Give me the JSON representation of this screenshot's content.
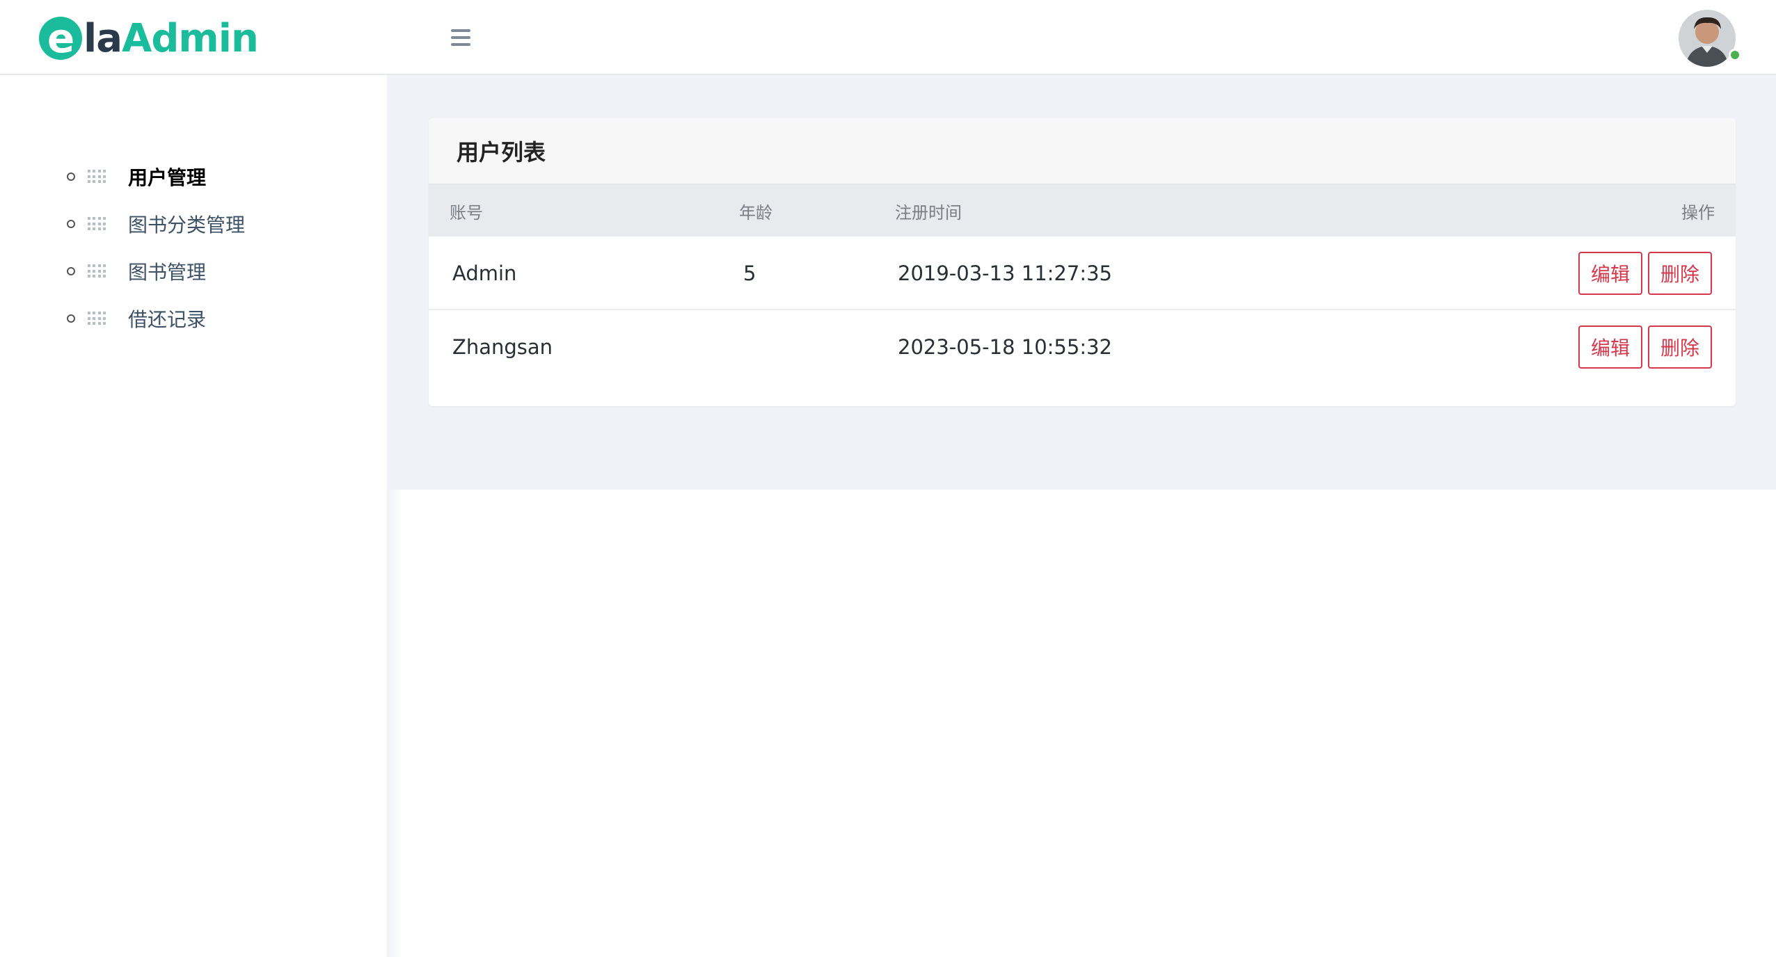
{
  "header": {
    "logo": {
      "e": "e",
      "la": "la",
      "admin": "Admin"
    },
    "menu_toggle_icon": "hamburger-menu-icon",
    "avatar_icon": "user-avatar",
    "status_color": "#4caf50"
  },
  "sidebar": {
    "items": [
      {
        "label": "用户管理",
        "active": true,
        "icon": "grid-icon"
      },
      {
        "label": "图书分类管理",
        "active": false,
        "icon": "grid-icon"
      },
      {
        "label": "图书管理",
        "active": false,
        "icon": "grid-icon"
      },
      {
        "label": "借还记录",
        "active": false,
        "icon": "grid-icon"
      }
    ]
  },
  "main": {
    "card_title": "用户列表",
    "columns": [
      "账号",
      "年龄",
      "注册时间",
      "操作"
    ],
    "rows": [
      {
        "account": "Admin",
        "age": "5",
        "registered": "2019-03-13 11:27:35",
        "edit": "编辑",
        "delete": "删除"
      },
      {
        "account": "Zhangsan",
        "age": "",
        "registered": "2023-05-18 10:55:32",
        "edit": "编辑",
        "delete": "删除"
      }
    ]
  },
  "colors": {
    "brand": "#1abc9c",
    "danger": "#d6374a"
  }
}
